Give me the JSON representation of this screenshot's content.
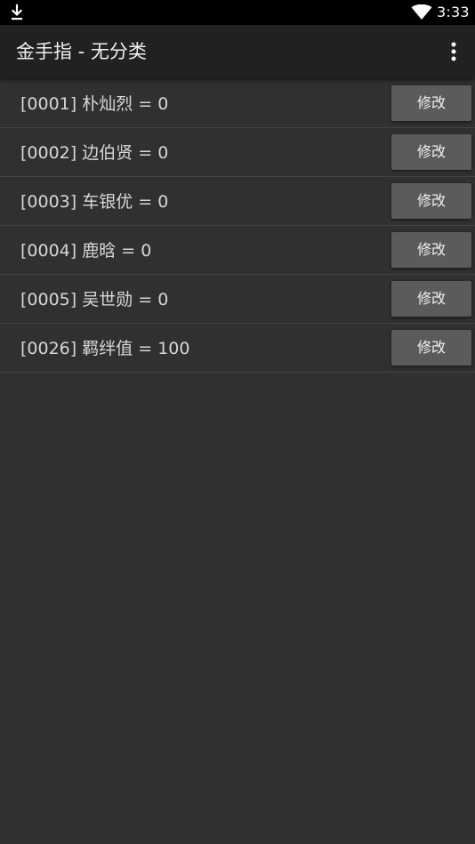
{
  "status_bar": {
    "time": "3:33",
    "icons": [
      "download-icon",
      "wifi-icon"
    ]
  },
  "app_bar": {
    "title": "金手指 - 无分类",
    "overflow_icon": "more-vert-icon"
  },
  "list": {
    "items": [
      {
        "label": "[0001] 朴灿烈 = 0",
        "button": "修改"
      },
      {
        "label": "[0002] 边伯贤 = 0",
        "button": "修改"
      },
      {
        "label": "[0003] 车银优 = 0",
        "button": "修改"
      },
      {
        "label": "[0004] 鹿晗 = 0",
        "button": "修改"
      },
      {
        "label": "[0005] 吴世勋 = 0",
        "button": "修改"
      },
      {
        "label": "[0026] 羁绊值 = 100",
        "button": "修改"
      }
    ]
  },
  "colors": {
    "background": "#303030",
    "app_bar": "#212121",
    "status_bar": "#000000",
    "button": "#5b5b5b",
    "divider": "#434343"
  }
}
